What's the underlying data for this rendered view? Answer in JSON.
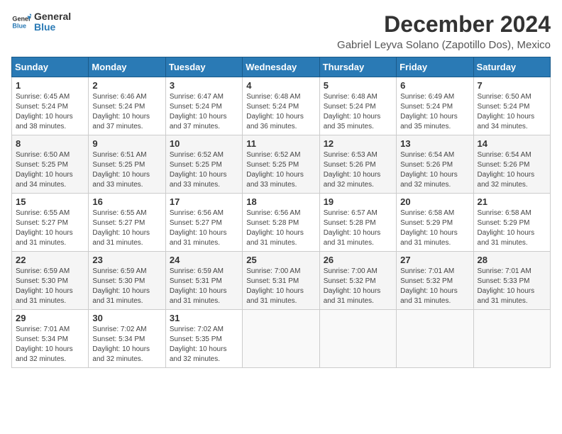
{
  "logo": {
    "line1": "General",
    "line2": "Blue"
  },
  "title": "December 2024",
  "subtitle": "Gabriel Leyva Solano (Zapotillo Dos), Mexico",
  "days_of_week": [
    "Sunday",
    "Monday",
    "Tuesday",
    "Wednesday",
    "Thursday",
    "Friday",
    "Saturday"
  ],
  "weeks": [
    [
      {
        "day": "1",
        "sunrise": "6:45 AM",
        "sunset": "5:24 PM",
        "daylight": "10 hours and 38 minutes."
      },
      {
        "day": "2",
        "sunrise": "6:46 AM",
        "sunset": "5:24 PM",
        "daylight": "10 hours and 37 minutes."
      },
      {
        "day": "3",
        "sunrise": "6:47 AM",
        "sunset": "5:24 PM",
        "daylight": "10 hours and 37 minutes."
      },
      {
        "day": "4",
        "sunrise": "6:48 AM",
        "sunset": "5:24 PM",
        "daylight": "10 hours and 36 minutes."
      },
      {
        "day": "5",
        "sunrise": "6:48 AM",
        "sunset": "5:24 PM",
        "daylight": "10 hours and 35 minutes."
      },
      {
        "day": "6",
        "sunrise": "6:49 AM",
        "sunset": "5:24 PM",
        "daylight": "10 hours and 35 minutes."
      },
      {
        "day": "7",
        "sunrise": "6:50 AM",
        "sunset": "5:24 PM",
        "daylight": "10 hours and 34 minutes."
      }
    ],
    [
      {
        "day": "8",
        "sunrise": "6:50 AM",
        "sunset": "5:25 PM",
        "daylight": "10 hours and 34 minutes."
      },
      {
        "day": "9",
        "sunrise": "6:51 AM",
        "sunset": "5:25 PM",
        "daylight": "10 hours and 33 minutes."
      },
      {
        "day": "10",
        "sunrise": "6:52 AM",
        "sunset": "5:25 PM",
        "daylight": "10 hours and 33 minutes."
      },
      {
        "day": "11",
        "sunrise": "6:52 AM",
        "sunset": "5:25 PM",
        "daylight": "10 hours and 33 minutes."
      },
      {
        "day": "12",
        "sunrise": "6:53 AM",
        "sunset": "5:26 PM",
        "daylight": "10 hours and 32 minutes."
      },
      {
        "day": "13",
        "sunrise": "6:54 AM",
        "sunset": "5:26 PM",
        "daylight": "10 hours and 32 minutes."
      },
      {
        "day": "14",
        "sunrise": "6:54 AM",
        "sunset": "5:26 PM",
        "daylight": "10 hours and 32 minutes."
      }
    ],
    [
      {
        "day": "15",
        "sunrise": "6:55 AM",
        "sunset": "5:27 PM",
        "daylight": "10 hours and 31 minutes."
      },
      {
        "day": "16",
        "sunrise": "6:55 AM",
        "sunset": "5:27 PM",
        "daylight": "10 hours and 31 minutes."
      },
      {
        "day": "17",
        "sunrise": "6:56 AM",
        "sunset": "5:27 PM",
        "daylight": "10 hours and 31 minutes."
      },
      {
        "day": "18",
        "sunrise": "6:56 AM",
        "sunset": "5:28 PM",
        "daylight": "10 hours and 31 minutes."
      },
      {
        "day": "19",
        "sunrise": "6:57 AM",
        "sunset": "5:28 PM",
        "daylight": "10 hours and 31 minutes."
      },
      {
        "day": "20",
        "sunrise": "6:58 AM",
        "sunset": "5:29 PM",
        "daylight": "10 hours and 31 minutes."
      },
      {
        "day": "21",
        "sunrise": "6:58 AM",
        "sunset": "5:29 PM",
        "daylight": "10 hours and 31 minutes."
      }
    ],
    [
      {
        "day": "22",
        "sunrise": "6:59 AM",
        "sunset": "5:30 PM",
        "daylight": "10 hours and 31 minutes."
      },
      {
        "day": "23",
        "sunrise": "6:59 AM",
        "sunset": "5:30 PM",
        "daylight": "10 hours and 31 minutes."
      },
      {
        "day": "24",
        "sunrise": "6:59 AM",
        "sunset": "5:31 PM",
        "daylight": "10 hours and 31 minutes."
      },
      {
        "day": "25",
        "sunrise": "7:00 AM",
        "sunset": "5:31 PM",
        "daylight": "10 hours and 31 minutes."
      },
      {
        "day": "26",
        "sunrise": "7:00 AM",
        "sunset": "5:32 PM",
        "daylight": "10 hours and 31 minutes."
      },
      {
        "day": "27",
        "sunrise": "7:01 AM",
        "sunset": "5:32 PM",
        "daylight": "10 hours and 31 minutes."
      },
      {
        "day": "28",
        "sunrise": "7:01 AM",
        "sunset": "5:33 PM",
        "daylight": "10 hours and 31 minutes."
      }
    ],
    [
      {
        "day": "29",
        "sunrise": "7:01 AM",
        "sunset": "5:34 PM",
        "daylight": "10 hours and 32 minutes."
      },
      {
        "day": "30",
        "sunrise": "7:02 AM",
        "sunset": "5:34 PM",
        "daylight": "10 hours and 32 minutes."
      },
      {
        "day": "31",
        "sunrise": "7:02 AM",
        "sunset": "5:35 PM",
        "daylight": "10 hours and 32 minutes."
      },
      null,
      null,
      null,
      null
    ]
  ],
  "labels": {
    "sunrise": "Sunrise:",
    "sunset": "Sunset:",
    "daylight": "Daylight:"
  }
}
